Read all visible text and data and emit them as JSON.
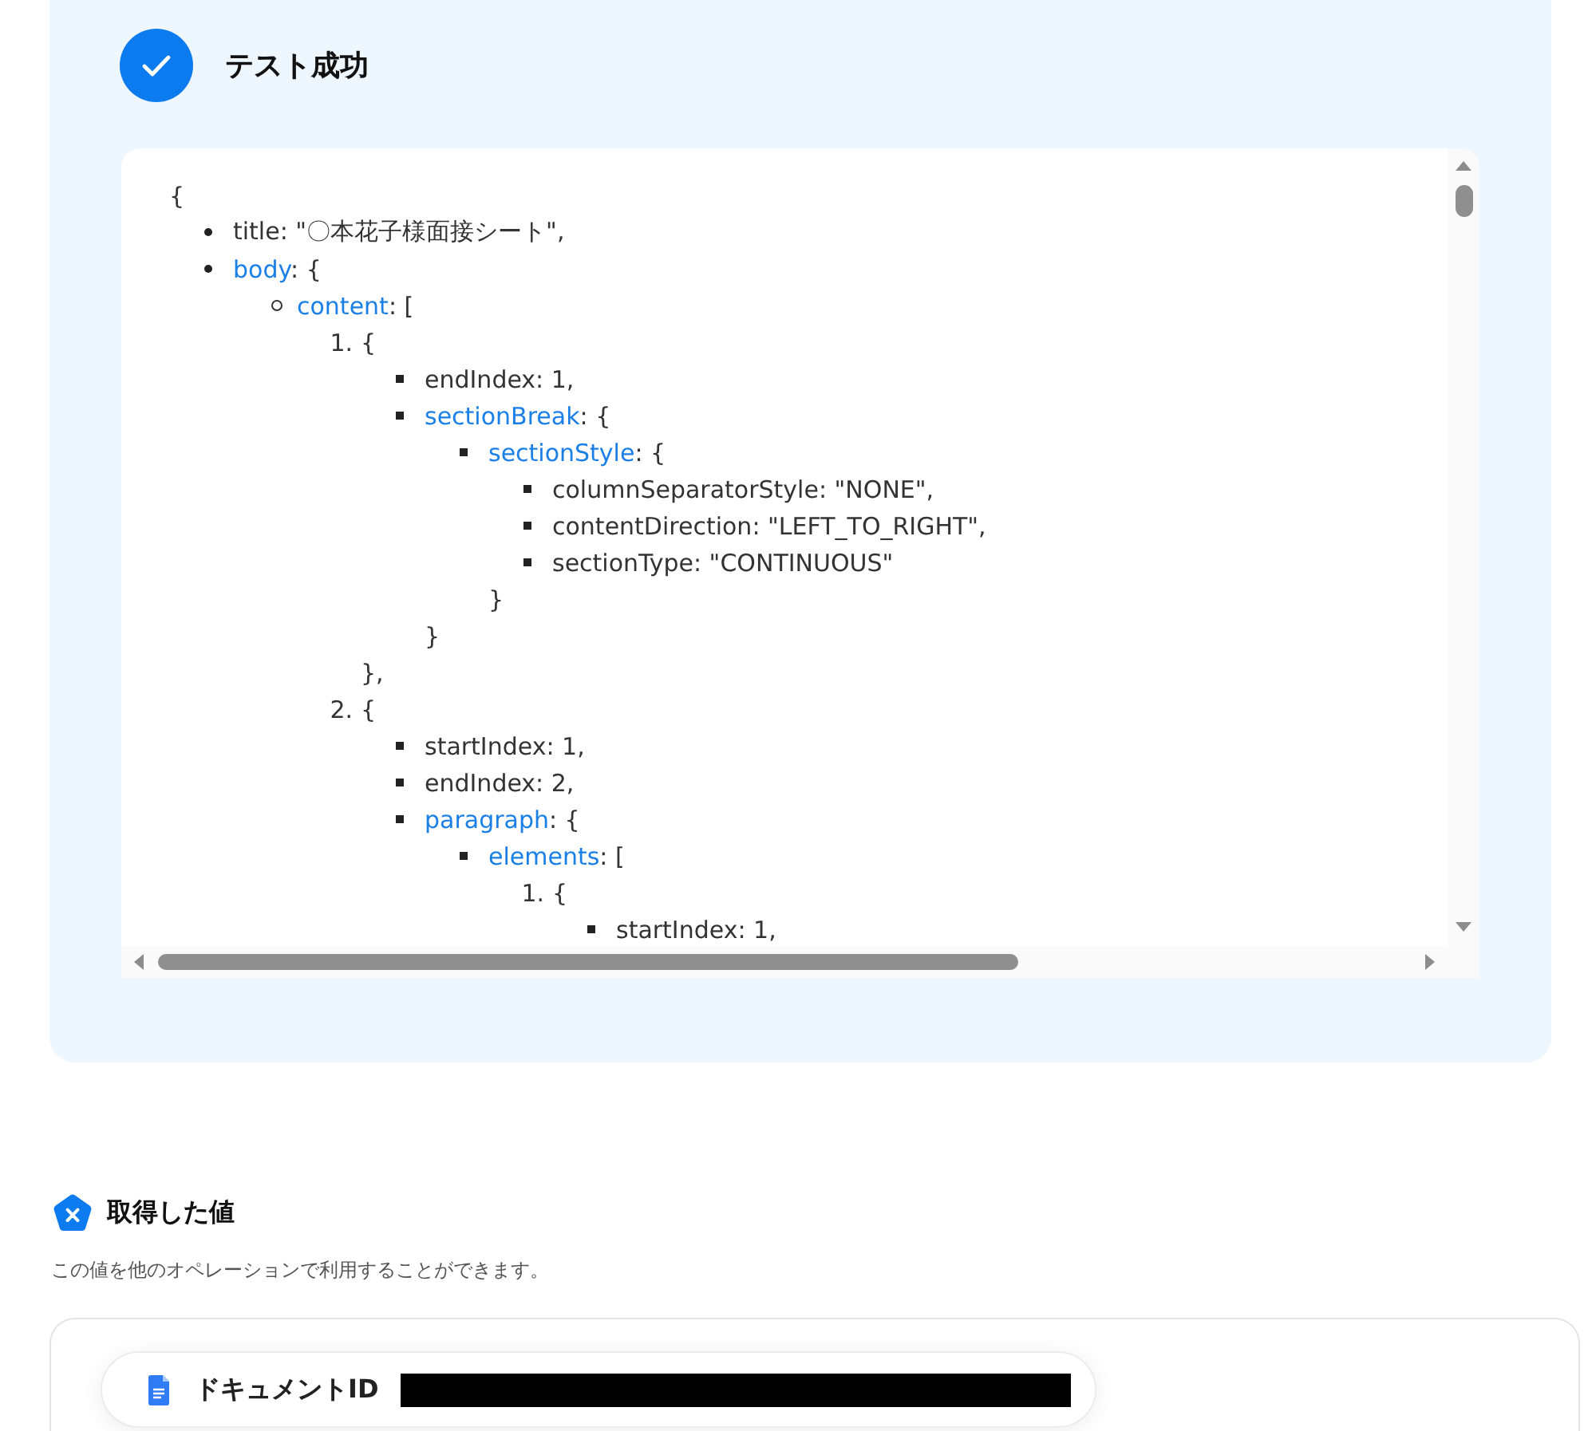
{
  "header": {
    "title": "テスト成功"
  },
  "code_view": {
    "open": "{",
    "items": [
      {
        "kind": "disc",
        "text": "title: \"〇本花子様面接シート\","
      },
      {
        "kind": "disc",
        "key": "body",
        "text": ": {",
        "children": [
          {
            "kind": "circle",
            "key": "content",
            "text": ": [",
            "children": [
              {
                "kind": "number",
                "number": "1.",
                "text": "{",
                "children": [
                  {
                    "kind": "square",
                    "text": "endIndex: 1,"
                  },
                  {
                    "kind": "square",
                    "key": "sectionBreak",
                    "text": ": {",
                    "children": [
                      {
                        "kind": "square",
                        "key": "sectionStyle",
                        "text": ": {",
                        "children": [
                          {
                            "kind": "square",
                            "text": "columnSeparatorStyle: \"NONE\","
                          },
                          {
                            "kind": "square",
                            "text": "contentDirection: \"LEFT_TO_RIGHT\","
                          },
                          {
                            "kind": "square",
                            "text": "sectionType: \"CONTINUOUS\""
                          }
                        ],
                        "close": "}"
                      }
                    ],
                    "close": "}"
                  }
                ],
                "close": "},"
              },
              {
                "kind": "number",
                "number": "2.",
                "text": "{",
                "children": [
                  {
                    "kind": "square",
                    "text": "startIndex: 1,"
                  },
                  {
                    "kind": "square",
                    "text": "endIndex: 2,"
                  },
                  {
                    "kind": "square",
                    "key": "paragraph",
                    "text": ": {",
                    "children": [
                      {
                        "kind": "square",
                        "key": "elements",
                        "text": ": [",
                        "children": [
                          {
                            "kind": "number",
                            "number": "1.",
                            "text": "{",
                            "children": [
                              {
                                "kind": "square",
                                "text": "startIndex: 1,"
                              }
                            ]
                          }
                        ]
                      }
                    ]
                  }
                ]
              }
            ]
          }
        ]
      }
    ]
  },
  "values_section": {
    "title": "取得した値",
    "description": "この値を他のオペレーションで利用することができます。",
    "fields": [
      {
        "label": "ドキュメントID",
        "redacted": true
      }
    ]
  }
}
